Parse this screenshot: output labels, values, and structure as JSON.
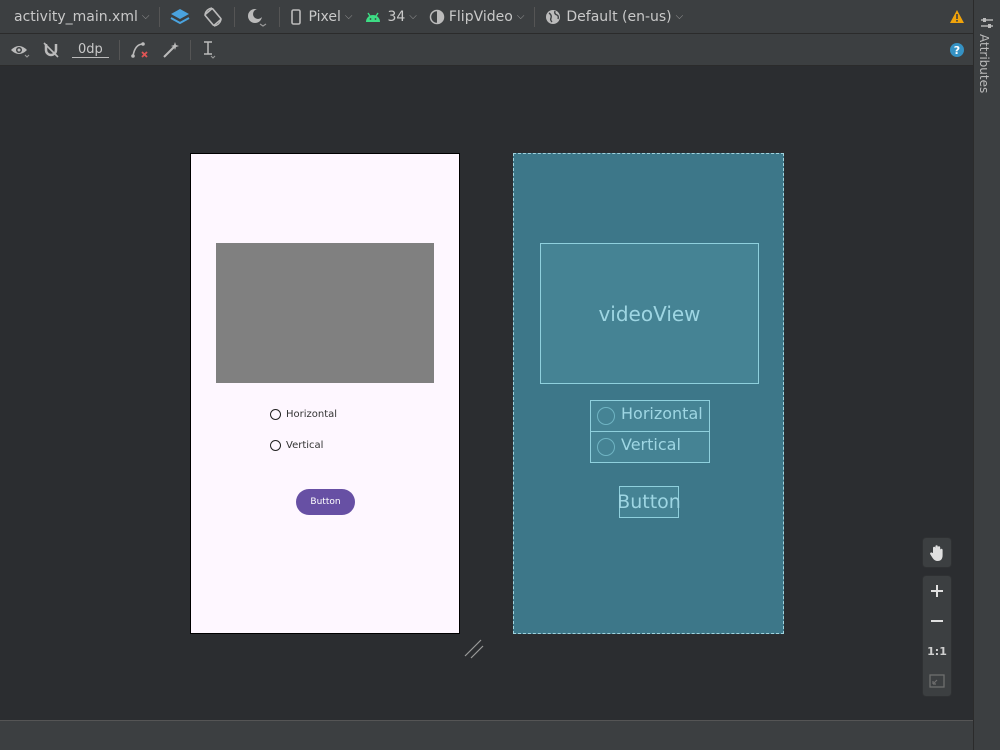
{
  "toolbar_top": {
    "file_name": "activity_main.xml",
    "device": "Pixel",
    "api_level": "34",
    "theme": "FlipVideo",
    "locale": "Default (en-us)",
    "icons": [
      "layers-icon",
      "rotate-icon",
      "night-mode-icon",
      "device-icon",
      "android-icon",
      "theme-icon",
      "globe-icon",
      "warning-icon"
    ]
  },
  "toolbar_second": {
    "margin_value": "0dp",
    "icons": [
      "eye-icon",
      "magnet-off-icon",
      "clear-constraints-icon",
      "infer-constraints-icon",
      "guidelines-icon",
      "help-icon"
    ]
  },
  "right_panel": {
    "label": "Attributes"
  },
  "design_surface": {
    "radio_1": "Horizontal",
    "radio_2": "Vertical",
    "button_label": "Button"
  },
  "blueprint_surface": {
    "video_label": "videoView",
    "radio_1": "Horizontal",
    "radio_2": "Vertical",
    "button_label": "Button"
  },
  "zoom_controls": {
    "one_to_one": "1:1"
  },
  "colors": {
    "toolbar": "#3c3f41",
    "canvas": "#2b2d30",
    "blueprint": "#3d7789",
    "button": "#6750a4",
    "warning": "#f0a30a",
    "android": "#3ddc84"
  }
}
